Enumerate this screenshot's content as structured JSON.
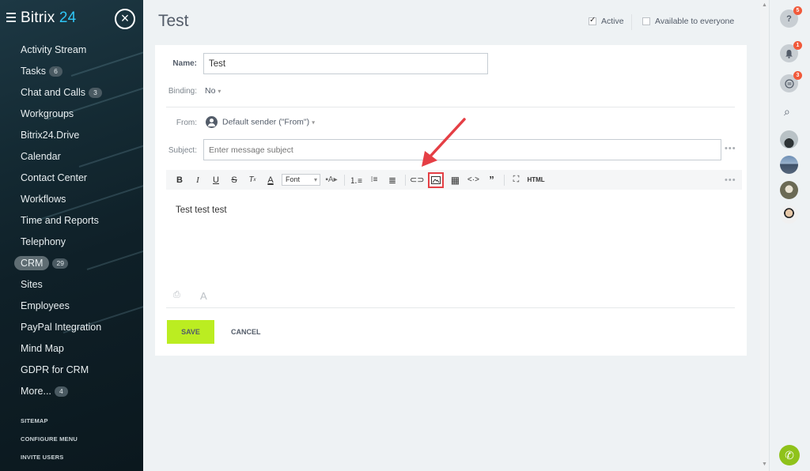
{
  "sidebar": {
    "brand_main": "Bitrix",
    "brand_num": "24",
    "items": [
      {
        "label": "Activity Stream",
        "count": ""
      },
      {
        "label": "Tasks",
        "count": "6"
      },
      {
        "label": "Chat and Calls",
        "count": "3"
      },
      {
        "label": "Workgroups",
        "count": ""
      },
      {
        "label": "Bitrix24.Drive",
        "count": ""
      },
      {
        "label": "Calendar",
        "count": ""
      },
      {
        "label": "Contact Center",
        "count": ""
      },
      {
        "label": "Workflows",
        "count": ""
      },
      {
        "label": "Time and Reports",
        "count": ""
      },
      {
        "label": "Telephony",
        "count": ""
      },
      {
        "label": "CRM",
        "count": "29"
      },
      {
        "label": "Sites",
        "count": ""
      },
      {
        "label": "Employees",
        "count": ""
      },
      {
        "label": "PayPal Integration",
        "count": ""
      },
      {
        "label": "Mind Map",
        "count": ""
      },
      {
        "label": "GDPR for CRM",
        "count": ""
      },
      {
        "label": "More...",
        "count": "4"
      }
    ],
    "bottom_links": [
      "SITEMAP",
      "CONFIGURE MENU",
      "INVITE USERS"
    ]
  },
  "header": {
    "title": "Test",
    "active_label": "Active",
    "available_label": "Available to everyone"
  },
  "form": {
    "name_label": "Name:",
    "name_value": "Test",
    "binding_label": "Binding:",
    "binding_value": "No",
    "from_label": "From:",
    "from_value": "Default sender (\"From\")",
    "subject_label": "Subject:",
    "subject_placeholder": "Enter message subject",
    "font_label": "Font",
    "html_label": "HTML",
    "body_text": "Test test test",
    "save_label": "SAVE",
    "cancel_label": "CANCEL"
  },
  "rightbar": {
    "help_badge": "5",
    "notify_badge": "1",
    "chat_badge": "3"
  }
}
